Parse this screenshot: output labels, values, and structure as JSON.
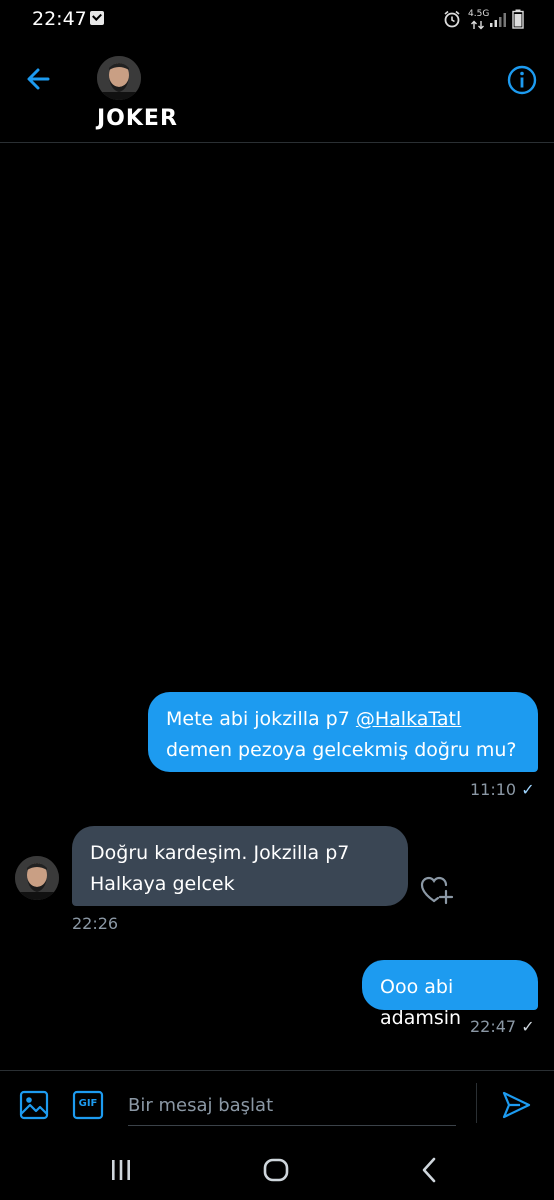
{
  "status_bar": {
    "time": "22:47",
    "network": "4.5G"
  },
  "conversation": {
    "name": "JOKER"
  },
  "messages": [
    {
      "pre": "Mete abi jokzilla p7 ",
      "mention": "@HalkaTatl",
      "post": " demen pezoya gelcekmiş doğru mu?",
      "time": "11:10",
      "read_mark": "✓"
    },
    {
      "text": "Doğru kardeşim. Jokzilla p7 Halkaya gelcek",
      "time": "22:26"
    },
    {
      "text": "Ooo abi adamsin",
      "time": "22:47",
      "read_mark": "✓"
    }
  ],
  "composer": {
    "placeholder": "Bir mesaj başlat",
    "gif_label": "GIF"
  },
  "colors": {
    "accent": "#1d9bf0",
    "received_bubble": "#3a4654",
    "background": "#000000",
    "muted": "#8b98a5"
  }
}
